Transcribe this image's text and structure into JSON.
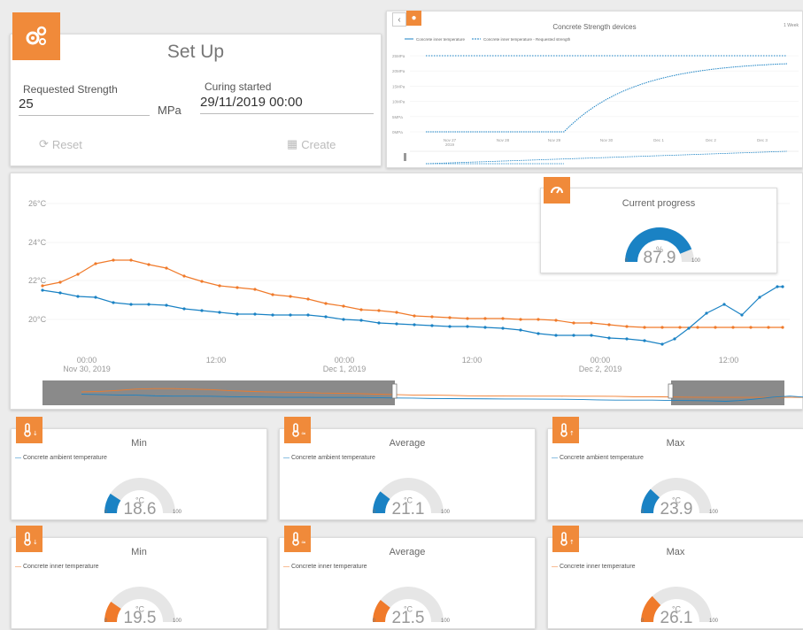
{
  "colors": {
    "accent": "#f08a3a",
    "blue": "#1a82c4",
    "orange": "#f07a2a",
    "gauge_bg": "#e6e6e6"
  },
  "setup": {
    "title": "Set Up",
    "requested_strength_label": "Requested Strength",
    "requested_strength_value": "25",
    "unit": "MPa",
    "curing_label": "Curing started",
    "curing_value": "29/11/2019 00:00",
    "reset_label": "Reset",
    "create_label": "Create",
    "icon": "gears-icon"
  },
  "strength_chart": {
    "title": "Concrete Strength devices",
    "legend": [
      "Concrete inner temperature",
      "Concrete inner temperature - Requested strength"
    ],
    "range_label": "1 Week",
    "y_ticks": [
      "25MPa",
      "20MPa",
      "15MPa",
      "10MPa",
      "5MPa",
      "0MPa"
    ],
    "x_ticks": [
      "Nov 27\n2019",
      "Nov 28",
      "Nov 29",
      "Nov 30",
      "Dec 1",
      "Dec 2",
      "Dec 3"
    ],
    "back_icon": "chevron-left-icon",
    "icon": "drop-icon"
  },
  "temp_chart": {
    "y_ticks": [
      "26°C",
      "24°C",
      "22°C",
      "20°C"
    ],
    "x_ticks": [
      {
        "time": "00:00",
        "date": "Nov 30, 2019"
      },
      {
        "time": "12:00",
        "date": ""
      },
      {
        "time": "00:00",
        "date": "Dec 1, 2019"
      },
      {
        "time": "12:00",
        "date": ""
      },
      {
        "time": "00:00",
        "date": "Dec 2, 2019"
      },
      {
        "time": "12:00",
        "date": ""
      }
    ]
  },
  "progress": {
    "title": "Current progress",
    "unit": "%",
    "value": "87.9",
    "fraction": 0.879,
    "min": "0",
    "max": "100",
    "icon": "speedometer-icon"
  },
  "ambient": {
    "series": "Concrete ambient temperature",
    "unit": "°C",
    "min": {
      "title": "Min",
      "value": "18.6",
      "fraction": 0.186,
      "icon": "thermometer-down-icon"
    },
    "avg": {
      "title": "Average",
      "value": "21.1",
      "fraction": 0.211,
      "icon": "thermometer-avg-icon"
    },
    "max": {
      "title": "Max",
      "value": "23.9",
      "fraction": 0.239,
      "icon": "thermometer-up-icon"
    },
    "scale_min": "0",
    "scale_max": "100"
  },
  "inner": {
    "series": "Concrete inner temperature",
    "unit": "°C",
    "min": {
      "title": "Min",
      "value": "19.5",
      "fraction": 0.195,
      "icon": "thermometer-down-icon"
    },
    "avg": {
      "title": "Average",
      "value": "21.5",
      "fraction": 0.215,
      "icon": "thermometer-avg-icon"
    },
    "max": {
      "title": "Max",
      "value": "26.1",
      "fraction": 0.261,
      "icon": "thermometer-up-icon"
    },
    "scale_min": "0",
    "scale_max": "100"
  }
}
